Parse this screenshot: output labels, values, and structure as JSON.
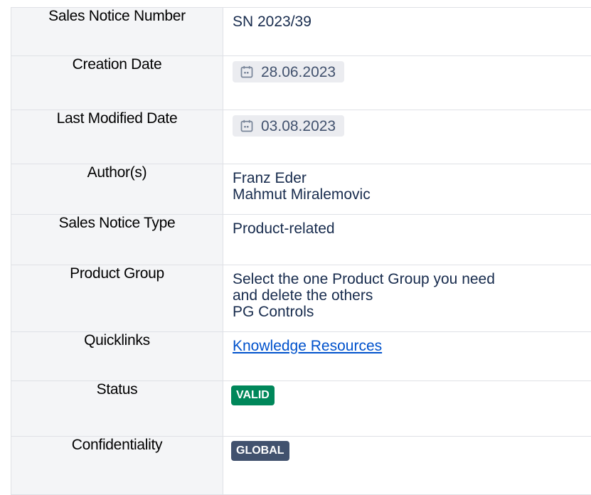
{
  "rows": [
    {
      "key": "Sales Notice Number",
      "value": "SN 2023/39"
    },
    {
      "key": "Creation Date",
      "value": "28.06.2023"
    },
    {
      "key": "Last Modified Date",
      "value": "03.08.2023"
    },
    {
      "key": "Author(s)",
      "lines": [
        "Franz Eder",
        "Mahmut Miralemovic"
      ]
    },
    {
      "key": "Sales Notice Type",
      "value": "Product-related"
    },
    {
      "key": "Product Group",
      "lines": [
        "Select the one Product Group you need",
        "and delete the others",
        "PG Controls"
      ]
    },
    {
      "key": "Quicklinks",
      "link": "Knowledge Resources"
    },
    {
      "key": "Status",
      "badge": "VALID",
      "badge_color": "#00875a"
    },
    {
      "key": "Confidentiality",
      "badge": "GLOBAL",
      "badge_color": "#42526e"
    }
  ],
  "icons": {
    "date": "calendar-icon"
  },
  "colors": {
    "key_bg": "#f4f5f7",
    "link": "#0052cc",
    "date_bg": "#ebecf0"
  }
}
